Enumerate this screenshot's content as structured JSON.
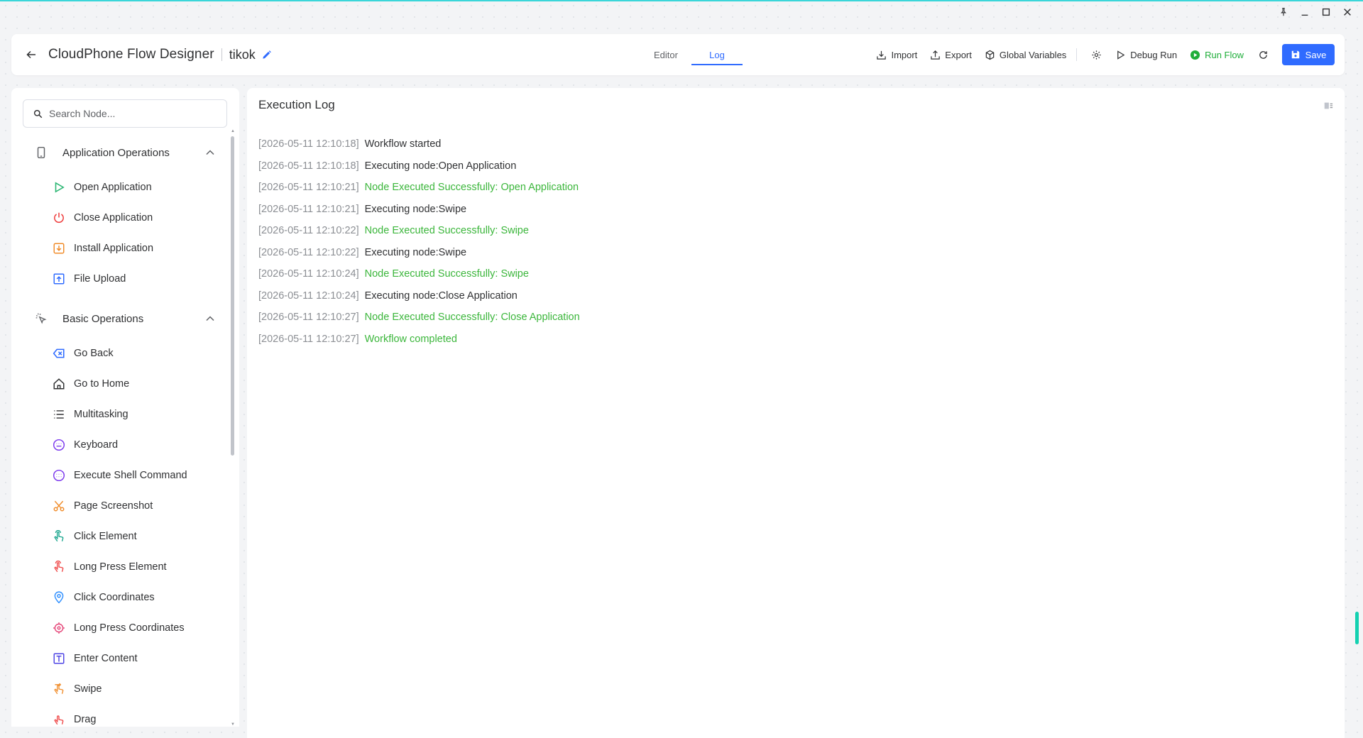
{
  "header": {
    "app_title": "CloudPhone Flow Designer",
    "flow_name": "tikok",
    "tabs": [
      {
        "label": "Editor",
        "active": false
      },
      {
        "label": "Log",
        "active": true
      }
    ],
    "toolbar": {
      "import": "Import",
      "export": "Export",
      "global_variables": "Global Variables",
      "debug_run": "Debug Run",
      "run_flow": "Run Flow",
      "save": "Save"
    }
  },
  "sidebar": {
    "search_placeholder": "Search Node...",
    "groups": [
      {
        "label": "Application Operations",
        "icon": "phone-icon",
        "expanded": true,
        "items": [
          {
            "label": "Open Application",
            "icon": "play-icon"
          },
          {
            "label": "Close Application",
            "icon": "power-icon"
          },
          {
            "label": "Install Application",
            "icon": "install-icon"
          },
          {
            "label": "File Upload",
            "icon": "upload-icon"
          }
        ]
      },
      {
        "label": "Basic Operations",
        "icon": "tap-icon",
        "expanded": true,
        "items": [
          {
            "label": "Go Back",
            "icon": "back-icon"
          },
          {
            "label": "Go to Home",
            "icon": "home-icon"
          },
          {
            "label": "Multitasking",
            "icon": "list-icon"
          },
          {
            "label": "Keyboard",
            "icon": "keyboard-icon"
          },
          {
            "label": "Execute Shell Command",
            "icon": "shell-icon"
          },
          {
            "label": "Page Screenshot",
            "icon": "scissors-icon"
          },
          {
            "label": "Click Element",
            "icon": "hand-click-icon"
          },
          {
            "label": "Long Press Element",
            "icon": "hand-press-icon"
          },
          {
            "label": "Click Coordinates",
            "icon": "location-icon"
          },
          {
            "label": "Long Press Coordinates",
            "icon": "target-icon"
          },
          {
            "label": "Enter Content",
            "icon": "text-icon"
          },
          {
            "label": "Swipe",
            "icon": "swipe-icon"
          },
          {
            "label": "Drag",
            "icon": "drag-icon"
          }
        ]
      }
    ]
  },
  "log": {
    "title": "Execution Log",
    "entries": [
      {
        "ts": "[2026-05-11 12:10:18]",
        "msg": "Workflow started",
        "success": false
      },
      {
        "ts": "[2026-05-11 12:10:18]",
        "msg": "Executing node:Open Application",
        "success": false
      },
      {
        "ts": "[2026-05-11 12:10:21]",
        "msg": "Node Executed Successfully: Open Application",
        "success": true
      },
      {
        "ts": "[2026-05-11 12:10:21]",
        "msg": "Executing node:Swipe",
        "success": false
      },
      {
        "ts": "[2026-05-11 12:10:22]",
        "msg": "Node Executed Successfully: Swipe",
        "success": true
      },
      {
        "ts": "[2026-05-11 12:10:22]",
        "msg": "Executing node:Swipe",
        "success": false
      },
      {
        "ts": "[2026-05-11 12:10:24]",
        "msg": "Node Executed Successfully: Swipe",
        "success": true
      },
      {
        "ts": "[2026-05-11 12:10:24]",
        "msg": "Executing node:Close Application",
        "success": false
      },
      {
        "ts": "[2026-05-11 12:10:27]",
        "msg": "Node Executed Successfully: Close Application",
        "success": true
      },
      {
        "ts": "[2026-05-11 12:10:27]",
        "msg": "Workflow completed",
        "success": true
      }
    ]
  },
  "colors": {
    "accent": "#2f6bff",
    "success": "#3bb63b",
    "run_flow": "#1fae3a",
    "timestamp": "#8c8f94"
  }
}
